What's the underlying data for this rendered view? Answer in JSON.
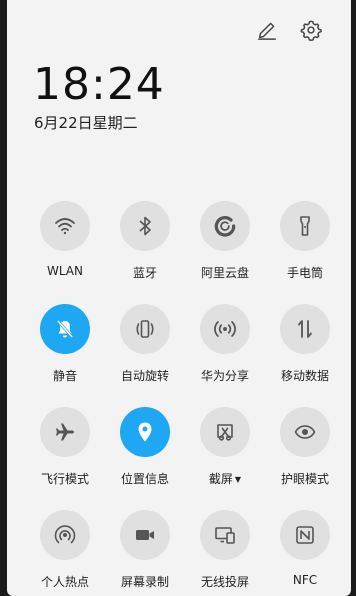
{
  "header": {
    "time": "18:24",
    "date": "6月22日星期二",
    "edit_icon": "pencil-icon",
    "settings_icon": "gear-icon"
  },
  "colors": {
    "active": "#1ea7f2",
    "inactive_circle": "#e0e0e0",
    "panel_bg": "#f3f3f3"
  },
  "toggles": [
    {
      "label": "WLAN",
      "icon": "wifi-icon",
      "active": false
    },
    {
      "label": "蓝牙",
      "icon": "bluetooth-icon",
      "active": false
    },
    {
      "label": "阿里云盘",
      "icon": "cloud-drive-icon",
      "active": false
    },
    {
      "label": "手电筒",
      "icon": "flashlight-icon",
      "active": false
    },
    {
      "label": "静音",
      "icon": "bell-muted-icon",
      "active": true
    },
    {
      "label": "自动旋转",
      "icon": "auto-rotate-icon",
      "active": false
    },
    {
      "label": "华为分享",
      "icon": "share-signal-icon",
      "active": false
    },
    {
      "label": "移动数据",
      "icon": "mobile-data-icon",
      "active": false
    },
    {
      "label": "飞行模式",
      "icon": "airplane-icon",
      "active": false
    },
    {
      "label": "位置信息",
      "icon": "location-pin-icon",
      "active": true
    },
    {
      "label": "截屏",
      "icon": "screenshot-icon",
      "active": false,
      "has_dropdown": true
    },
    {
      "label": "护眼模式",
      "icon": "eye-icon",
      "active": false
    },
    {
      "label": "个人热点",
      "icon": "hotspot-icon",
      "active": false
    },
    {
      "label": "屏幕录制",
      "icon": "video-record-icon",
      "active": false
    },
    {
      "label": "无线投屏",
      "icon": "screen-cast-icon",
      "active": false
    },
    {
      "label": "NFC",
      "icon": "nfc-icon",
      "active": false
    }
  ]
}
